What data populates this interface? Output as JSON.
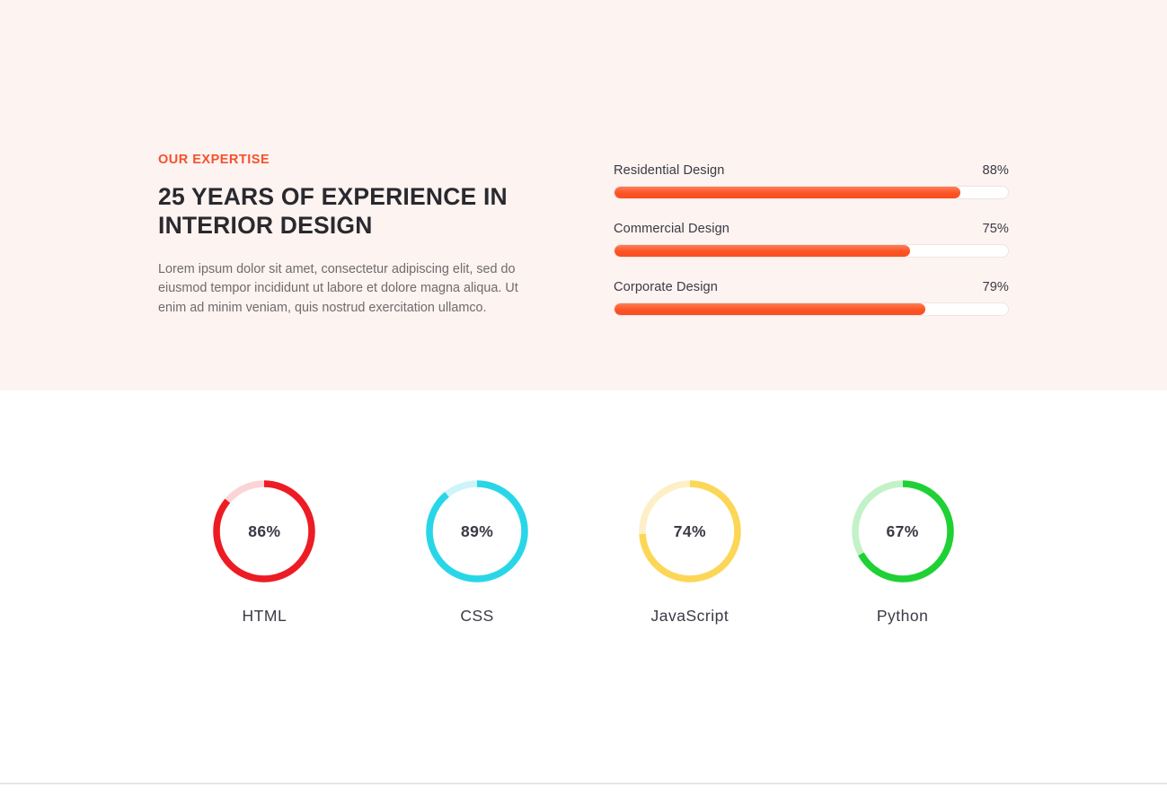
{
  "expertise": {
    "eyebrow": "OUR EXPERTISE",
    "headline": "25 YEARS OF EXPERIENCE IN INTERIOR DESIGN",
    "paragraph": "Lorem ipsum dolor sit amet, consectetur adipiscing elit, sed do eiusmod tempor incididunt ut labore et dolore magna aliqua. Ut enim ad minim veniam, quis nostrud exercitation ullamco.",
    "background_color": "#fdf3f0",
    "accent_color": "#f5512c",
    "bars": [
      {
        "label": "Residential Design",
        "value": 88,
        "value_label": "88%",
        "fill_color": "#fb5426",
        "track_color": "#ffffff"
      },
      {
        "label": "Commercial Design",
        "value": 75,
        "value_label": "75%",
        "fill_color": "#fb5426",
        "track_color": "#ffffff"
      },
      {
        "label": "Corporate Design",
        "value": 79,
        "value_label": "79%",
        "fill_color": "#fb5426",
        "track_color": "#ffffff"
      }
    ]
  },
  "skills": {
    "background_color": "#ffffff",
    "items": [
      {
        "name": "HTML",
        "value": 86,
        "value_label": "86%",
        "color": "#ed1c24",
        "track_color": "#fbd4d5"
      },
      {
        "name": "CSS",
        "value": 89,
        "value_label": "89%",
        "color": "#29d6e8",
        "track_color": "#cdf4f9"
      },
      {
        "name": "JavaScript",
        "value": 74,
        "value_label": "74%",
        "color": "#fcd757",
        "track_color": "#fdf0c7"
      },
      {
        "name": "Python",
        "value": 67,
        "value_label": "67%",
        "color": "#1fd134",
        "track_color": "#c3f2c8"
      }
    ]
  },
  "chart_data": [
    {
      "type": "bar",
      "title": "Our Expertise",
      "orientation": "horizontal",
      "categories": [
        "Residential Design",
        "Commercial Design",
        "Corporate Design"
      ],
      "values": [
        88,
        75,
        79
      ],
      "xlabel": "",
      "ylabel": "",
      "xlim": [
        0,
        100
      ],
      "grid": false,
      "legend": "none",
      "unit": "%"
    },
    {
      "type": "pie",
      "title": "Skills",
      "variant": "donut-gauges",
      "categories": [
        "HTML",
        "CSS",
        "JavaScript",
        "Python"
      ],
      "values": [
        86,
        89,
        74,
        67
      ],
      "colors": [
        "#ed1c24",
        "#29d6e8",
        "#fcd757",
        "#1fd134"
      ],
      "xlabel": "",
      "ylabel": "",
      "ylim": [
        0,
        100
      ],
      "grid": false,
      "legend": "below-each",
      "unit": "%"
    }
  ]
}
